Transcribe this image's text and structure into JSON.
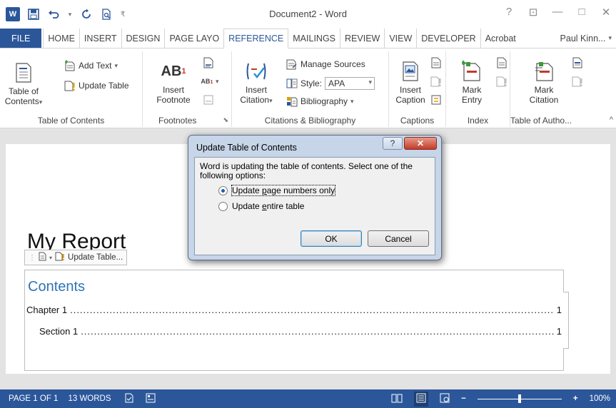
{
  "window": {
    "title": "Document2 - Word",
    "quick_access": [
      "save-icon",
      "undo-icon",
      "redo-icon",
      "print-preview-icon"
    ],
    "controls": {
      "help": "?",
      "restore": "⊡",
      "minimize": "—",
      "maximize": "□",
      "close": "✕"
    }
  },
  "tabs": [
    {
      "label": "FILE"
    },
    {
      "label": "HOME"
    },
    {
      "label": "INSERT"
    },
    {
      "label": "DESIGN"
    },
    {
      "label": "PAGE LAYO"
    },
    {
      "label": "REFERENCE"
    },
    {
      "label": "MAILINGS"
    },
    {
      "label": "REVIEW"
    },
    {
      "label": "VIEW"
    },
    {
      "label": "DEVELOPER"
    },
    {
      "label": "Acrobat"
    }
  ],
  "active_tab": "REFERENCE",
  "user": "Paul Kinn...",
  "ribbon": {
    "toc": {
      "group": "Table of Contents",
      "table_of_contents_line1": "Table of",
      "table_of_contents_line2": "Contents",
      "add_text": "Add Text",
      "update_table": "Update Table"
    },
    "footnotes": {
      "group": "Footnotes",
      "insert_footnote_line1": "Insert",
      "insert_footnote_line2": "Footnote",
      "ab_glyph": "AB"
    },
    "citations": {
      "group": "Citations & Bibliography",
      "insert_citation_line1": "Insert",
      "insert_citation_line2": "Citation",
      "manage_sources": "Manage Sources",
      "style_label": "Style:",
      "style_value": "APA",
      "bibliography": "Bibliography"
    },
    "captions": {
      "group": "Captions",
      "insert_caption_line1": "Insert",
      "insert_caption_line2": "Caption"
    },
    "index": {
      "group": "Index",
      "mark_entry_line1": "Mark",
      "mark_entry_line2": "Entry"
    },
    "authorities": {
      "group": "Table of Autho...",
      "mark_citation_line1": "Mark",
      "mark_citation_line2": "Citation"
    }
  },
  "document": {
    "title": "My Report",
    "toc_toolbar_label": "Update Table...",
    "contents_heading": "Contents",
    "entries": [
      {
        "text": "Chapter 1",
        "page": "1"
      },
      {
        "text": "Section 1",
        "page": "1"
      }
    ]
  },
  "dialog": {
    "title": "Update Table of Contents",
    "help": "?",
    "close": "✕",
    "message": "Word is updating the table of contents.  Select one of the following options:",
    "option1_pre": "Update ",
    "option1_u": "p",
    "option1_post": "age numbers only",
    "option2_pre": "Update ",
    "option2_u": "e",
    "option2_post": "ntire table",
    "selected_option": "Update page numbers only",
    "ok": "OK",
    "cancel": "Cancel"
  },
  "status": {
    "page": "PAGE 1 OF 1",
    "words": "13 WORDS",
    "zoom": "100%",
    "zoom_level": 1.0
  },
  "colors": {
    "brand": "#2b579a",
    "heading": "#2e74b5",
    "dialog_frame": "#c6d5e8"
  }
}
